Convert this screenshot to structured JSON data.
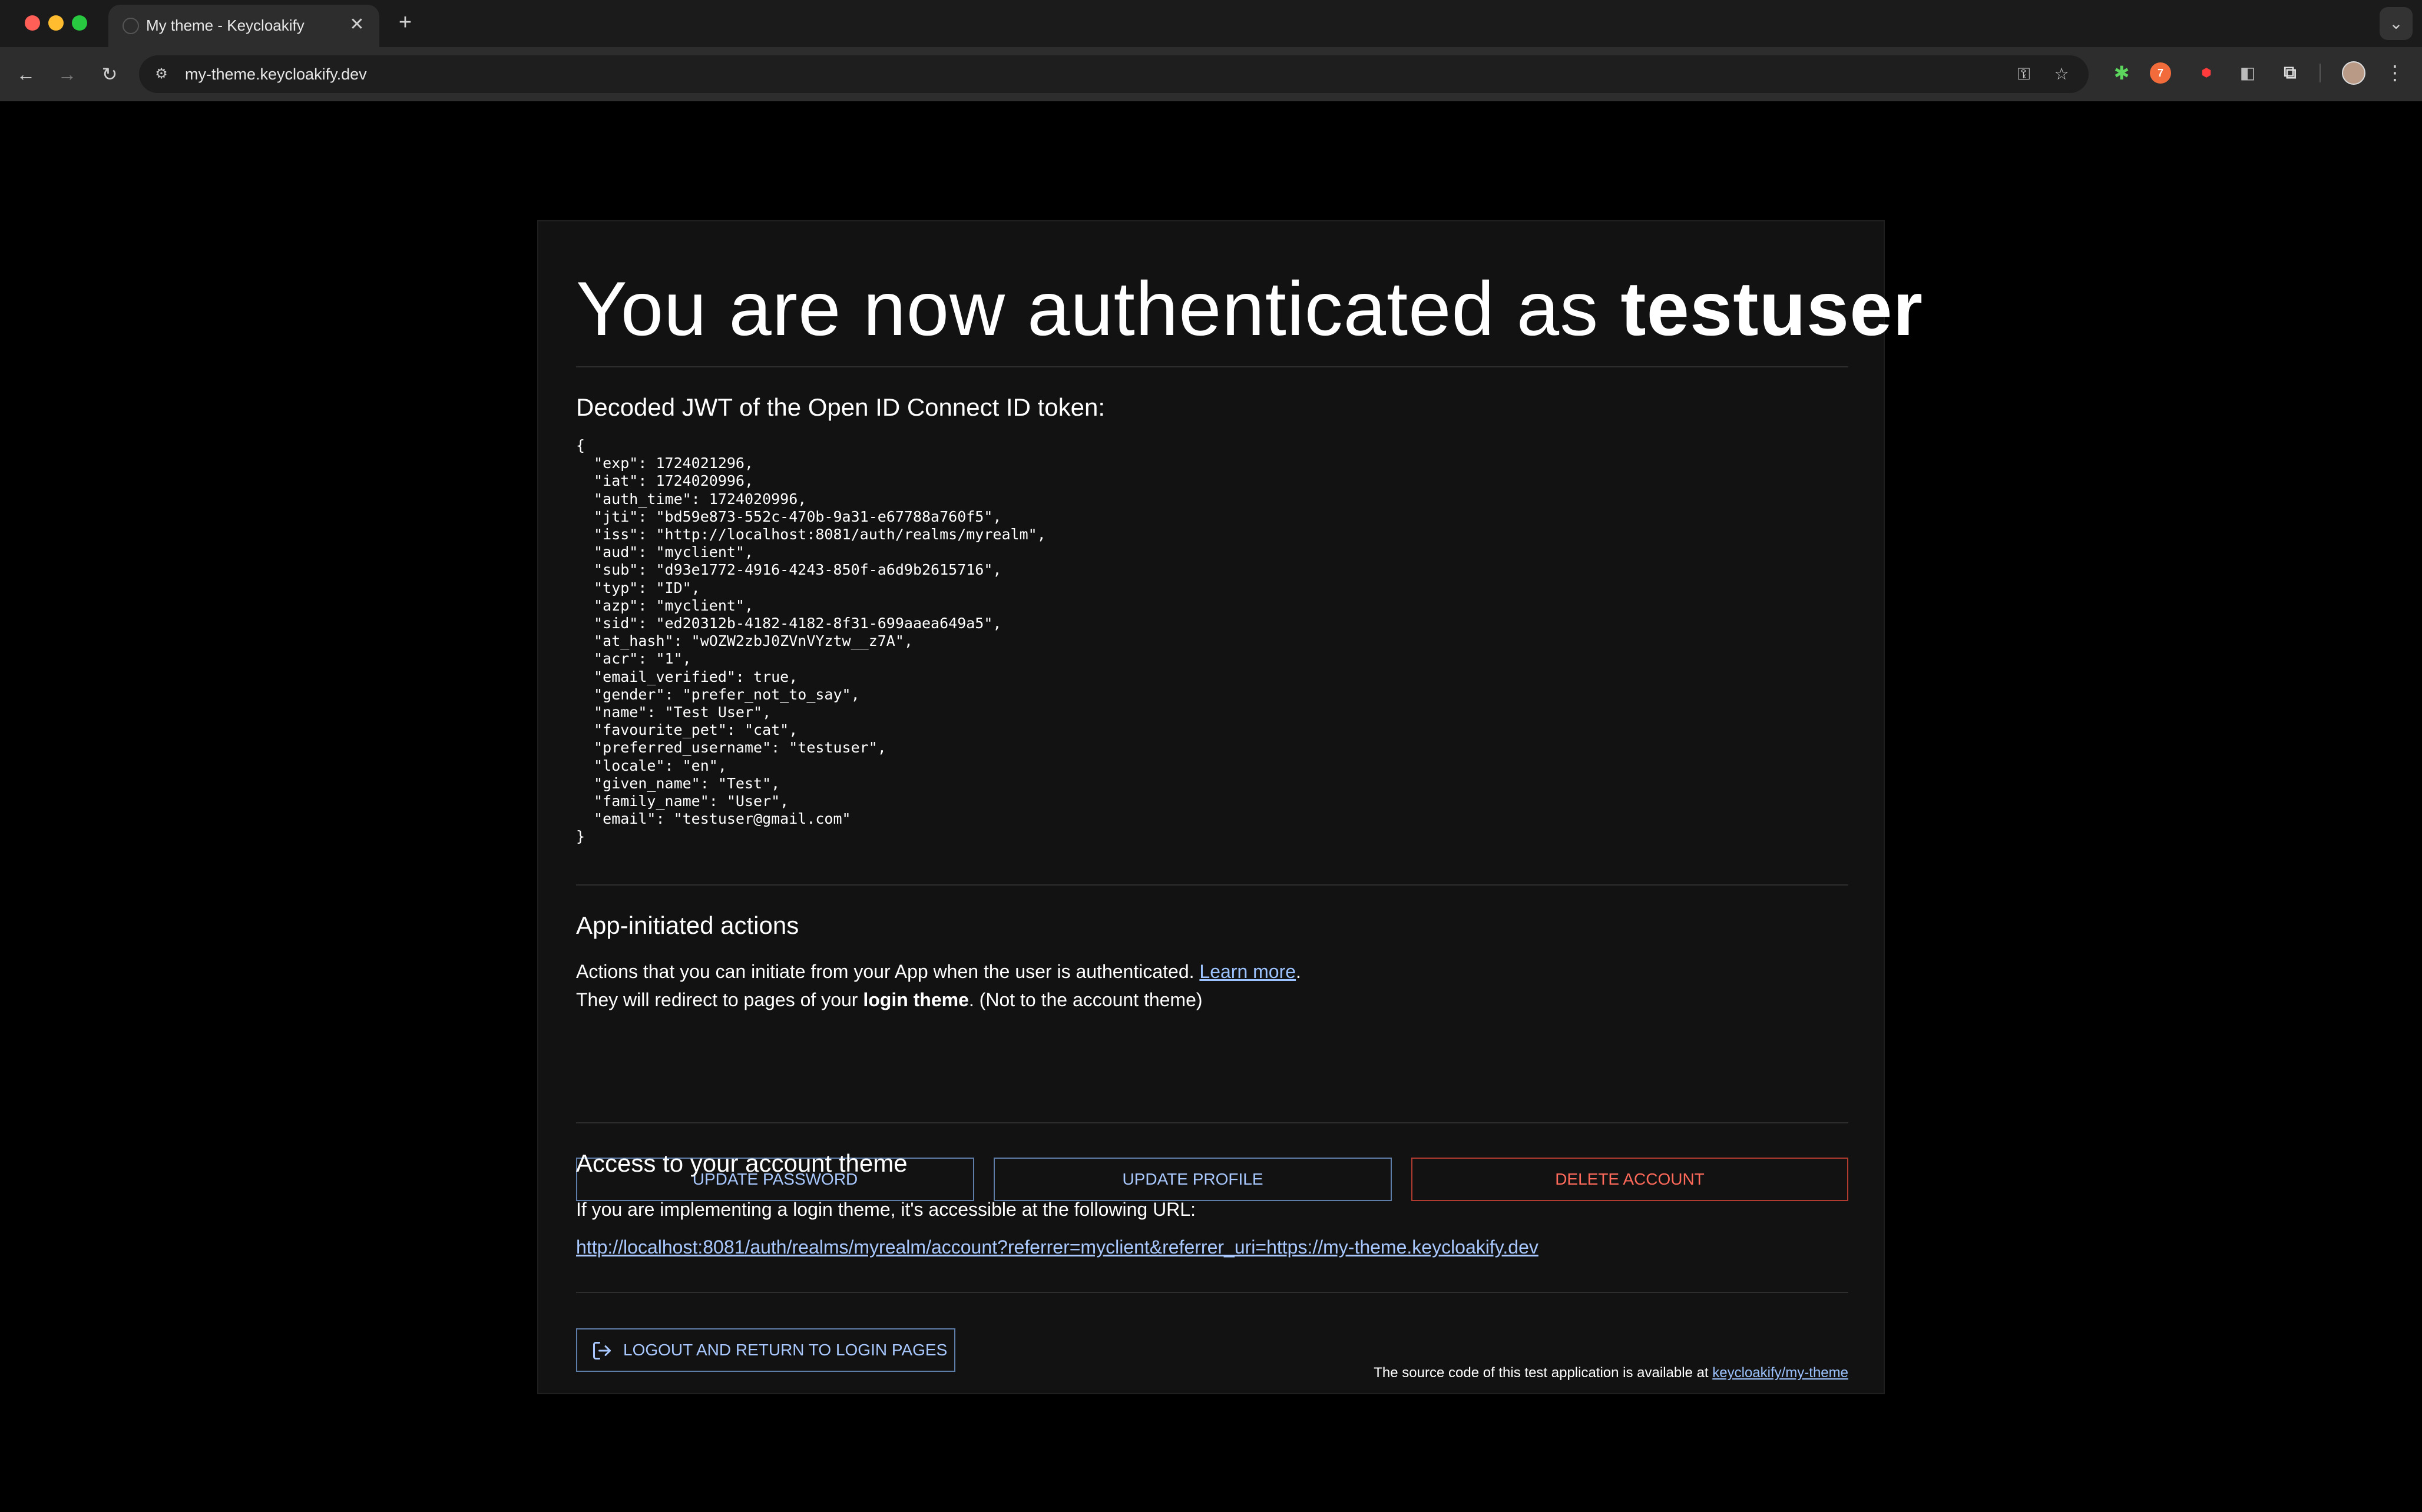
{
  "browser": {
    "tab_title": "My theme - Keycloakify",
    "url": "my-theme.keycloakify.dev",
    "icons": {
      "back": "back-arrow-icon",
      "forward": "forward-arrow-icon",
      "reload": "reload-icon",
      "site_info": "site-info-icon",
      "password": "key-icon",
      "bookmark": "star-icon",
      "menu": "kebab-menu-icon"
    }
  },
  "page": {
    "headline_prefix": "You are now authenticated as ",
    "headline_user": "testuser",
    "jwt_heading": "Decoded JWT of the Open ID Connect ID token:",
    "jwt_lines": [
      "{",
      "  \"exp\": 1724021296,",
      "  \"iat\": 1724020996,",
      "  \"auth_time\": 1724020996,",
      "  \"jti\": \"bd59e873-552c-470b-9a31-e67788a760f5\",",
      "  \"iss\": \"http://localhost:8081/auth/realms/myrealm\",",
      "  \"aud\": \"myclient\",",
      "  \"sub\": \"d93e1772-4916-4243-850f-a6d9b2615716\",",
      "  \"typ\": \"ID\",",
      "  \"azp\": \"myclient\",",
      "  \"sid\": \"ed20312b-4182-4182-8f31-699aaea649a5\",",
      "  \"at_hash\": \"wOZW2zbJ0ZVnVYztw__z7A\",",
      "  \"acr\": \"1\",",
      "  \"email_verified\": true,",
      "  \"gender\": \"prefer_not_to_say\",",
      "  \"name\": \"Test User\",",
      "  \"favourite_pet\": \"cat\",",
      "  \"preferred_username\": \"testuser\",",
      "  \"locale\": \"en\",",
      "  \"given_name\": \"Test\",",
      "  \"family_name\": \"User\",",
      "  \"email\": \"testuser@gmail.com\"",
      "}"
    ],
    "actions_heading": "App-initiated actions",
    "actions_text_1": "Actions that you can initiate from your App when the user is authenticated. ",
    "actions_learn_more": "Learn more",
    "actions_text_1_end": ".",
    "actions_text_2_prefix": "They will redirect to pages of your ",
    "actions_text_2_bold": "login theme",
    "actions_text_2_suffix": ". (Not to the account theme)",
    "buttons": {
      "update_password": "Update password",
      "update_profile": "Update profile",
      "delete_account": "Delete account"
    },
    "account_heading": "Access to your account theme",
    "account_text": "If you are implementing a login theme, it's accessible at the following URL:",
    "account_url": "http://localhost:8081/auth/realms/myrealm/account?referrer=myclient&referrer_uri=https://my-theme.keycloakify.dev",
    "logout_label": "Logout and return to login pages",
    "footer_text": "The source code of this test application is available at ",
    "footer_link": "keycloakify/my-theme"
  },
  "colors": {
    "link": "#9cc3ff",
    "button_primary": "#a8c8ff",
    "button_danger": "#ff6a5a"
  }
}
